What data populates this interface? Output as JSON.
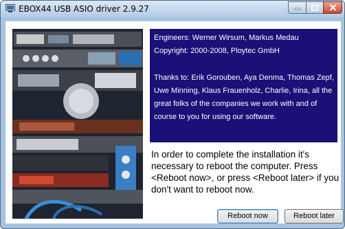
{
  "window": {
    "title": "EBOX44 USB ASIO driver 2.9.27"
  },
  "controls": {
    "minimize": "minimize-icon",
    "maximize": "maximize-icon",
    "close": "close-icon"
  },
  "credits": {
    "engineers": "Engineers: Werner Wirsum, Markus Medau",
    "copyright": "Copyright: 2000-2008, Ploytec GmbH",
    "thanks": "Thanks to: Erik Gorouben, Aya Denma, Thomas Zepf, Uwe Minning, Klaus Frauenholz, Charlie, Irina, all the great folks of the companies we work with and of course to you for using our software."
  },
  "message": "In order to complete the installation it's necessary to reboot the computer. Press <Reboot now>, or press <Reboot later> if you don't want to reboot now.",
  "buttons": {
    "reboot_now": "Reboot now",
    "reboot_later": "Reboot later"
  },
  "colors": {
    "info_background": "#1a1078",
    "titlebar": "#b3cbe5",
    "close_button": "#c74b30"
  }
}
